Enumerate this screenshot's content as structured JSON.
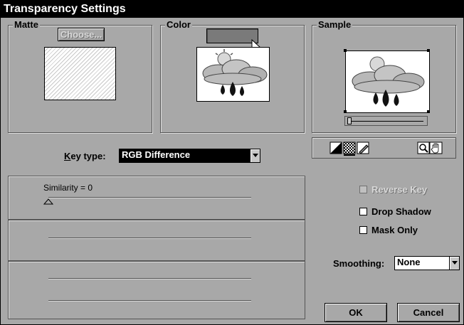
{
  "window": {
    "title": "Transparency Settings"
  },
  "matte": {
    "label": "Matte",
    "choose_button": "Choose..."
  },
  "color": {
    "label": "Color",
    "swatch_color": "#7a7a7a"
  },
  "sample": {
    "label": "Sample"
  },
  "key_type": {
    "label": "Key type:",
    "value": "RGB Difference"
  },
  "sliders": {
    "similarity_label": "Similarity = 0"
  },
  "options": {
    "reverse_key": "Reverse Key",
    "drop_shadow": "Drop Shadow",
    "mask_only": "Mask Only"
  },
  "smoothing": {
    "label": "Smoothing:",
    "value": "None"
  },
  "buttons": {
    "ok": "OK",
    "cancel": "Cancel"
  },
  "colors": {
    "dialog_bg": "#a8a8a8",
    "title_bg": "#000000",
    "select_bg": "#000000"
  }
}
